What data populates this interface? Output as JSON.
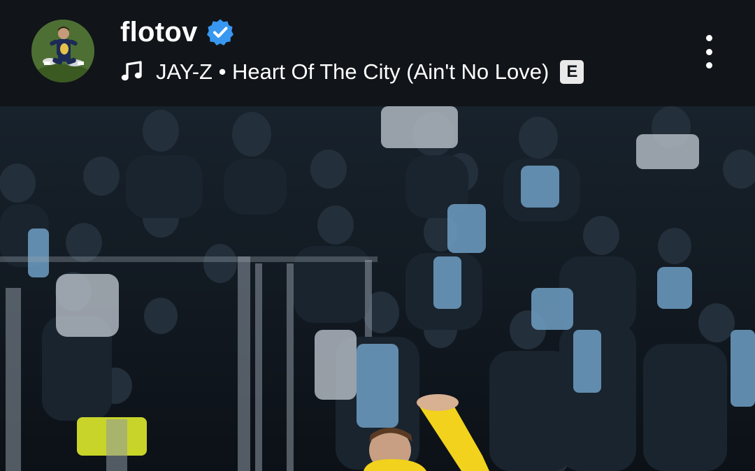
{
  "post_header": {
    "username": "flotov",
    "verified": true,
    "verified_icon": "verified-badge-icon",
    "music": {
      "icon": "music-note-icon",
      "text": "JAY-Z • Heart Of The City (Ain't No Love)",
      "explicit_label": "E"
    },
    "more_icon": "more-vertical-icon"
  },
  "post_media": {
    "description_icon": "photo"
  },
  "colors": {
    "background": "#111418",
    "verified_blue": "#3897f0",
    "text": "#ffffff",
    "player_yellow": "#f2d21c"
  }
}
